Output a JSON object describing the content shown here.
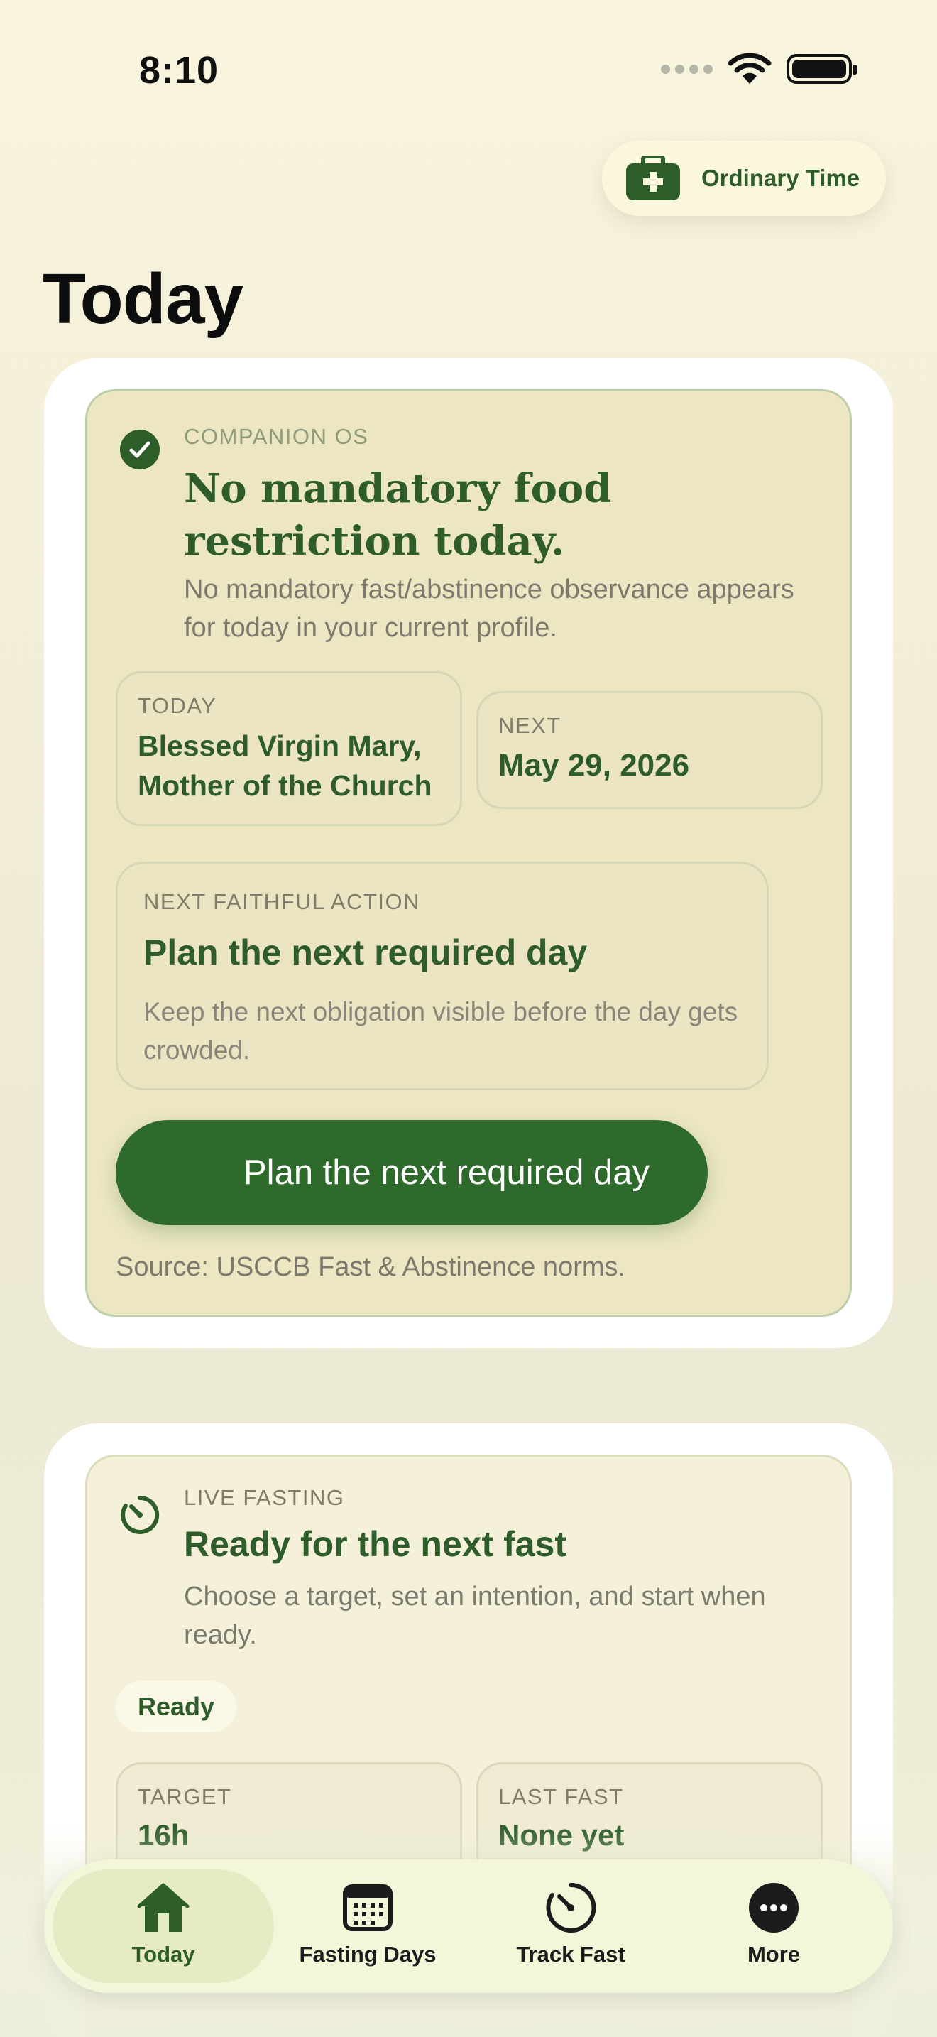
{
  "status_bar": {
    "time": "8:10"
  },
  "header": {
    "season_label": "Ordinary Time",
    "page_title": "Today"
  },
  "observance_card": {
    "eyebrow": "COMPANION OS",
    "headline": "No mandatory food restriction today.",
    "description": "No mandatory fast/abstinence observance appears for today in your current profile.",
    "today_label": "TODAY",
    "today_value": "Blessed Virgin Mary, Mother of the Church",
    "next_label": "NEXT",
    "next_value": "May 29, 2026",
    "action_label": "NEXT FAITHFUL ACTION",
    "action_title": "Plan the next required day",
    "action_description": "Keep the next obligation visible before the day gets crowded.",
    "button_label": "Plan the next required day",
    "source": "Source: USCCB Fast & Abstinence norms."
  },
  "live_fasting_card": {
    "eyebrow": "LIVE FASTING",
    "title": "Ready for the next fast",
    "description": "Choose a target, set an intention, and start when ready.",
    "status_chip": "Ready",
    "target_label": "TARGET",
    "target_value": "16h",
    "last_fast_label": "LAST FAST",
    "last_fast_value": "None yet"
  },
  "tab_bar": {
    "active": "Today",
    "items": [
      {
        "label": "Today",
        "icon": "house-icon"
      },
      {
        "label": "Fasting Days",
        "icon": "calendar-icon"
      },
      {
        "label": "Track Fast",
        "icon": "timer-icon"
      },
      {
        "label": "More",
        "icon": "ellipsis-icon"
      }
    ]
  },
  "colors": {
    "accent_green": "#2d6a2c",
    "text_green": "#2e5c2a",
    "card_tan": "#ece6c3"
  }
}
